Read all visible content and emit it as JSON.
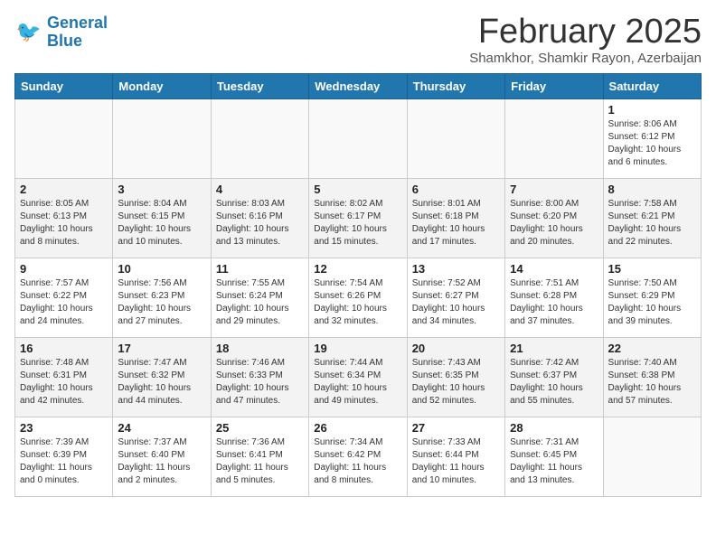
{
  "header": {
    "logo_line1": "General",
    "logo_line2": "Blue",
    "month_title": "February 2025",
    "subtitle": "Shamkhor, Shamkir Rayon, Azerbaijan"
  },
  "days_of_week": [
    "Sunday",
    "Monday",
    "Tuesday",
    "Wednesday",
    "Thursday",
    "Friday",
    "Saturday"
  ],
  "weeks": [
    [
      {
        "day": "",
        "info": ""
      },
      {
        "day": "",
        "info": ""
      },
      {
        "day": "",
        "info": ""
      },
      {
        "day": "",
        "info": ""
      },
      {
        "day": "",
        "info": ""
      },
      {
        "day": "",
        "info": ""
      },
      {
        "day": "1",
        "info": "Sunrise: 8:06 AM\nSunset: 6:12 PM\nDaylight: 10 hours and 6 minutes."
      }
    ],
    [
      {
        "day": "2",
        "info": "Sunrise: 8:05 AM\nSunset: 6:13 PM\nDaylight: 10 hours and 8 minutes."
      },
      {
        "day": "3",
        "info": "Sunrise: 8:04 AM\nSunset: 6:15 PM\nDaylight: 10 hours and 10 minutes."
      },
      {
        "day": "4",
        "info": "Sunrise: 8:03 AM\nSunset: 6:16 PM\nDaylight: 10 hours and 13 minutes."
      },
      {
        "day": "5",
        "info": "Sunrise: 8:02 AM\nSunset: 6:17 PM\nDaylight: 10 hours and 15 minutes."
      },
      {
        "day": "6",
        "info": "Sunrise: 8:01 AM\nSunset: 6:18 PM\nDaylight: 10 hours and 17 minutes."
      },
      {
        "day": "7",
        "info": "Sunrise: 8:00 AM\nSunset: 6:20 PM\nDaylight: 10 hours and 20 minutes."
      },
      {
        "day": "8",
        "info": "Sunrise: 7:58 AM\nSunset: 6:21 PM\nDaylight: 10 hours and 22 minutes."
      }
    ],
    [
      {
        "day": "9",
        "info": "Sunrise: 7:57 AM\nSunset: 6:22 PM\nDaylight: 10 hours and 24 minutes."
      },
      {
        "day": "10",
        "info": "Sunrise: 7:56 AM\nSunset: 6:23 PM\nDaylight: 10 hours and 27 minutes."
      },
      {
        "day": "11",
        "info": "Sunrise: 7:55 AM\nSunset: 6:24 PM\nDaylight: 10 hours and 29 minutes."
      },
      {
        "day": "12",
        "info": "Sunrise: 7:54 AM\nSunset: 6:26 PM\nDaylight: 10 hours and 32 minutes."
      },
      {
        "day": "13",
        "info": "Sunrise: 7:52 AM\nSunset: 6:27 PM\nDaylight: 10 hours and 34 minutes."
      },
      {
        "day": "14",
        "info": "Sunrise: 7:51 AM\nSunset: 6:28 PM\nDaylight: 10 hours and 37 minutes."
      },
      {
        "day": "15",
        "info": "Sunrise: 7:50 AM\nSunset: 6:29 PM\nDaylight: 10 hours and 39 minutes."
      }
    ],
    [
      {
        "day": "16",
        "info": "Sunrise: 7:48 AM\nSunset: 6:31 PM\nDaylight: 10 hours and 42 minutes."
      },
      {
        "day": "17",
        "info": "Sunrise: 7:47 AM\nSunset: 6:32 PM\nDaylight: 10 hours and 44 minutes."
      },
      {
        "day": "18",
        "info": "Sunrise: 7:46 AM\nSunset: 6:33 PM\nDaylight: 10 hours and 47 minutes."
      },
      {
        "day": "19",
        "info": "Sunrise: 7:44 AM\nSunset: 6:34 PM\nDaylight: 10 hours and 49 minutes."
      },
      {
        "day": "20",
        "info": "Sunrise: 7:43 AM\nSunset: 6:35 PM\nDaylight: 10 hours and 52 minutes."
      },
      {
        "day": "21",
        "info": "Sunrise: 7:42 AM\nSunset: 6:37 PM\nDaylight: 10 hours and 55 minutes."
      },
      {
        "day": "22",
        "info": "Sunrise: 7:40 AM\nSunset: 6:38 PM\nDaylight: 10 hours and 57 minutes."
      }
    ],
    [
      {
        "day": "23",
        "info": "Sunrise: 7:39 AM\nSunset: 6:39 PM\nDaylight: 11 hours and 0 minutes."
      },
      {
        "day": "24",
        "info": "Sunrise: 7:37 AM\nSunset: 6:40 PM\nDaylight: 11 hours and 2 minutes."
      },
      {
        "day": "25",
        "info": "Sunrise: 7:36 AM\nSunset: 6:41 PM\nDaylight: 11 hours and 5 minutes."
      },
      {
        "day": "26",
        "info": "Sunrise: 7:34 AM\nSunset: 6:42 PM\nDaylight: 11 hours and 8 minutes."
      },
      {
        "day": "27",
        "info": "Sunrise: 7:33 AM\nSunset: 6:44 PM\nDaylight: 11 hours and 10 minutes."
      },
      {
        "day": "28",
        "info": "Sunrise: 7:31 AM\nSunset: 6:45 PM\nDaylight: 11 hours and 13 minutes."
      },
      {
        "day": "",
        "info": ""
      }
    ]
  ]
}
